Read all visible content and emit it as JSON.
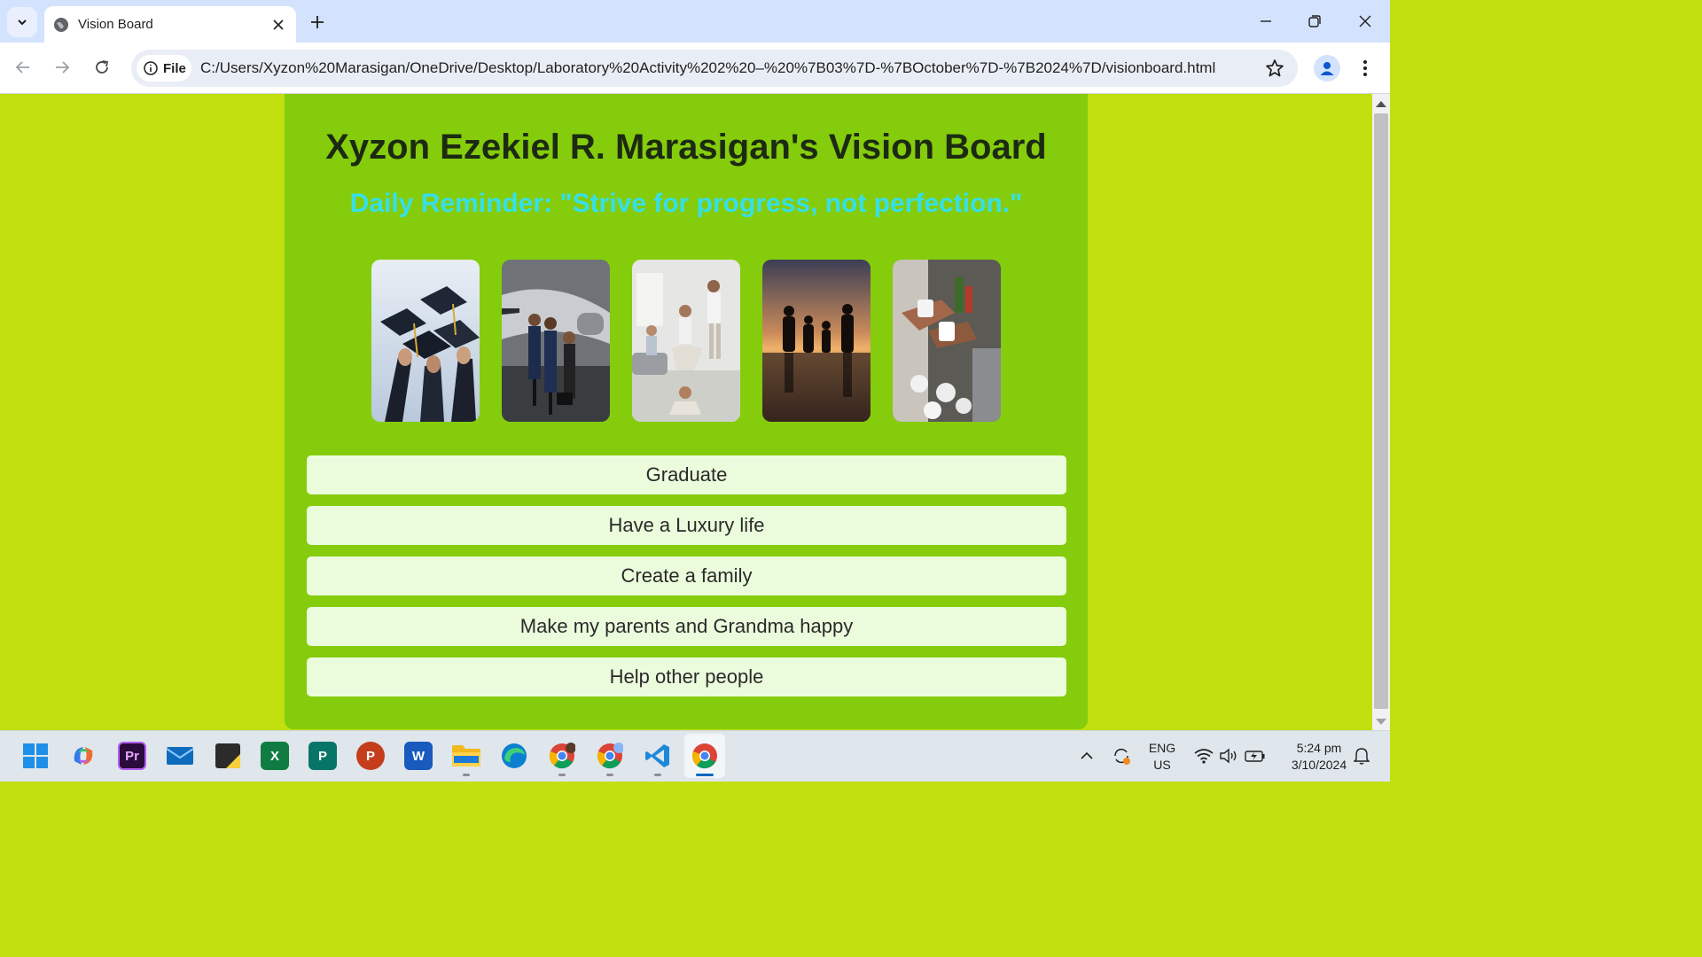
{
  "browser": {
    "tab_title": "Vision Board",
    "file_label": "File",
    "url": "C:/Users/Xyzon%20Marasigan/OneDrive/Desktop/Laboratory%20Activity%202%20–%20%7B03%7D-%7BOctober%7D-%7B2024%7D/visionboard.html"
  },
  "page": {
    "title": "Xyzon Ezekiel R. Marasigan's Vision Board",
    "reminder": "Daily Reminder: \"Strive for progress, not perfection.\"",
    "photos": [
      {
        "name": "graduation-photo"
      },
      {
        "name": "luxury-jet-photo"
      },
      {
        "name": "family-home-photo"
      },
      {
        "name": "family-sunset-photo"
      },
      {
        "name": "helping-people-photo"
      }
    ],
    "goals": [
      "Graduate",
      "Have a Luxury life",
      "Create a family",
      "Make my parents and Grandma happy",
      "Help other people"
    ]
  },
  "taskbar": {
    "lang_line1": "ENG",
    "lang_line2": "US",
    "time": "5:24 pm",
    "date": "3/10/2024",
    "apps": [
      "start",
      "copilot",
      "premiere-pro",
      "mail",
      "sticky-notes",
      "excel",
      "publisher",
      "powerpoint",
      "word",
      "file-explorer",
      "edge",
      "chrome-profile-1",
      "chrome-profile-2",
      "vscode",
      "chrome"
    ],
    "app_labels": {
      "premiere": "Pr",
      "excel": "X",
      "publisher": "P",
      "powerpoint": "P",
      "word": "W"
    }
  },
  "colors": {
    "page_bg": "#c2e00f",
    "board_bg": "#85cc0c",
    "reminder": "#35e0e8",
    "goal_bg": "#ebfcdc"
  }
}
